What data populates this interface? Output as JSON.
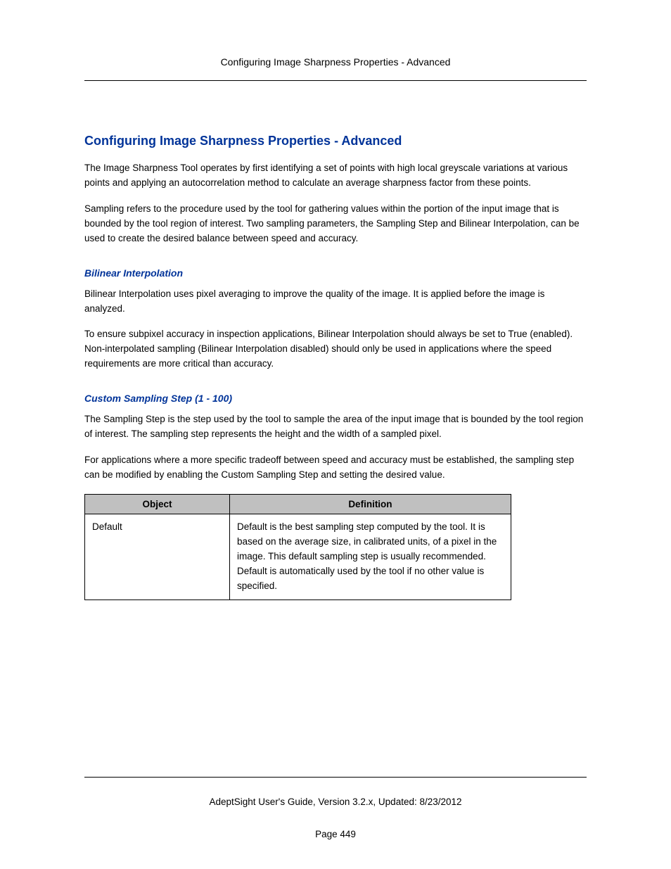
{
  "header": {
    "running_title": "Configuring Image Sharpness Properties - Advanced"
  },
  "main": {
    "title": "Configuring Image Sharpness Properties - Advanced",
    "intro_p1": "The Image Sharpness Tool operates by first identifying a set of points with high local greyscale variations at various points and applying an autocorrelation method to calculate an average sharpness factor from these points.",
    "intro_p2": "Sampling refers to the procedure used by the tool for gathering values within the portion of the input image that is bounded by the tool region of interest. Two sampling parameters, the Sampling Step and Bilinear Interpolation, can be used to create the desired balance between speed and accuracy.",
    "section1": {
      "heading": "Bilinear Interpolation",
      "p1": "Bilinear Interpolation uses pixel averaging to improve the quality of the image. It is applied before the image is analyzed.",
      "p2": "To ensure subpixel accuracy in inspection applications, Bilinear Interpolation should always be set to True (enabled). Non-interpolated sampling (Bilinear Interpolation disabled) should only be used in applications where the speed requirements are more critical than accuracy."
    },
    "section2": {
      "heading": "Custom Sampling Step (1 - 100)",
      "p1": "The Sampling Step is the step used by the tool to sample the area of the input image that is bounded by the tool region of interest. The sampling step represents the height and the width of a sampled pixel.",
      "p2": "For applications where a more specific tradeoff between speed and accuracy must be established, the sampling step can be modified by enabling the Custom Sampling Step and setting the desired value."
    },
    "table": {
      "headers": {
        "col1": "Object",
        "col2": "Definition"
      },
      "rows": [
        {
          "object": "Default",
          "definition": "Default is the best sampling step computed by the tool. It is based on the average size, in calibrated units, of a pixel in the image. This default sampling step is usually recommended. Default is automatically used by the tool if no other value is specified."
        }
      ]
    }
  },
  "footer": {
    "guide_info": "AdeptSight User's Guide,  Version 3.2.x, Updated: 8/23/2012",
    "page_number": "Page 449"
  }
}
